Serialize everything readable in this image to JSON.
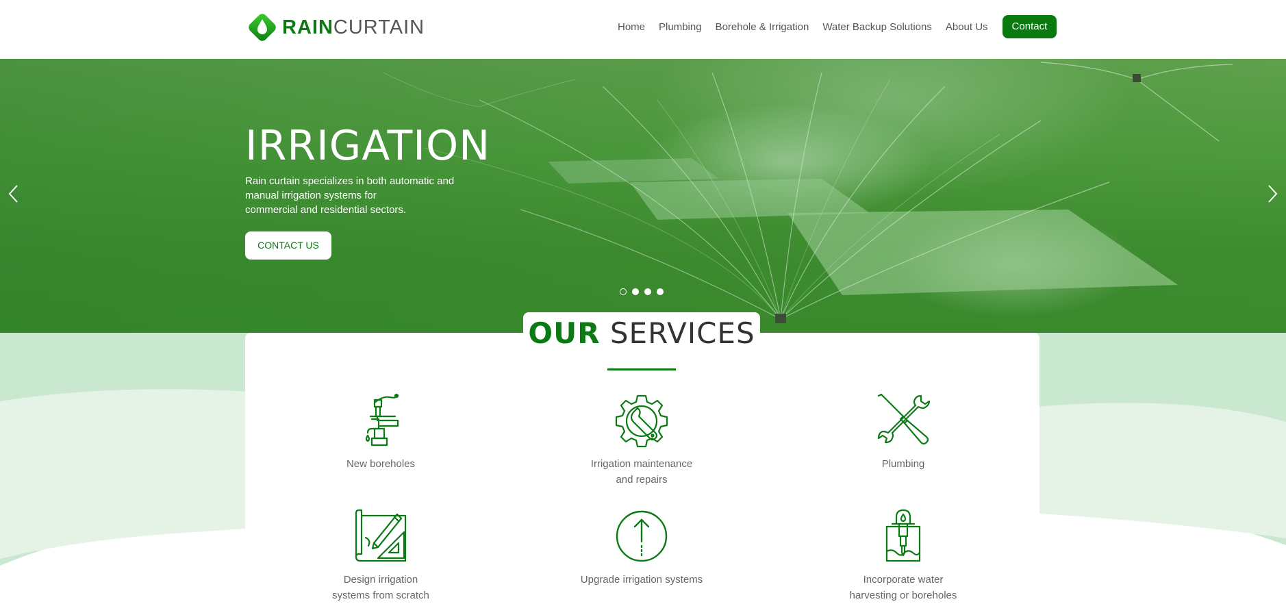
{
  "brand": {
    "name_part1": "RAIN",
    "name_part2": "CURTAIN",
    "primary_color": "#0b7a15",
    "logo_gradient": [
      "#3fd12e",
      "#0b7a15"
    ]
  },
  "nav": {
    "items": [
      "Home",
      "Plumbing",
      "Borehole & Irrigation",
      "Water Backup Solutions",
      "About Us"
    ],
    "contact_label": "Contact"
  },
  "hero": {
    "title": "IRRIGATION",
    "description_lines": [
      "Rain curtain specializes in both automatic and",
      "manual irrigation systems for",
      "commercial and residential sectors."
    ],
    "button_label": "CONTACT US",
    "prev_icon": "chevron-left-icon",
    "next_icon": "chevron-right-icon",
    "slides_count": 4,
    "active_slide": 1
  },
  "services": {
    "title_part1": "OUR",
    "title_part2": "SERVICES",
    "items": [
      {
        "icon": "borehole-pump-icon",
        "label_lines": [
          "New boreholes"
        ]
      },
      {
        "icon": "gear-wrench-icon",
        "label_lines": [
          "Irrigation maintenance",
          "and repairs"
        ]
      },
      {
        "icon": "screwdriver-wrench-icon",
        "label_lines": [
          "Plumbing"
        ]
      },
      {
        "icon": "blueprint-pencil-icon",
        "label_lines": [
          "Design irrigation",
          "systems from scratch"
        ]
      },
      {
        "icon": "upgrade-arrow-icon",
        "label_lines": [
          "Upgrade irrigation systems"
        ]
      },
      {
        "icon": "water-harvesting-icon",
        "label_lines": [
          "Incorporate water",
          "harvesting or boreholes"
        ]
      }
    ]
  }
}
